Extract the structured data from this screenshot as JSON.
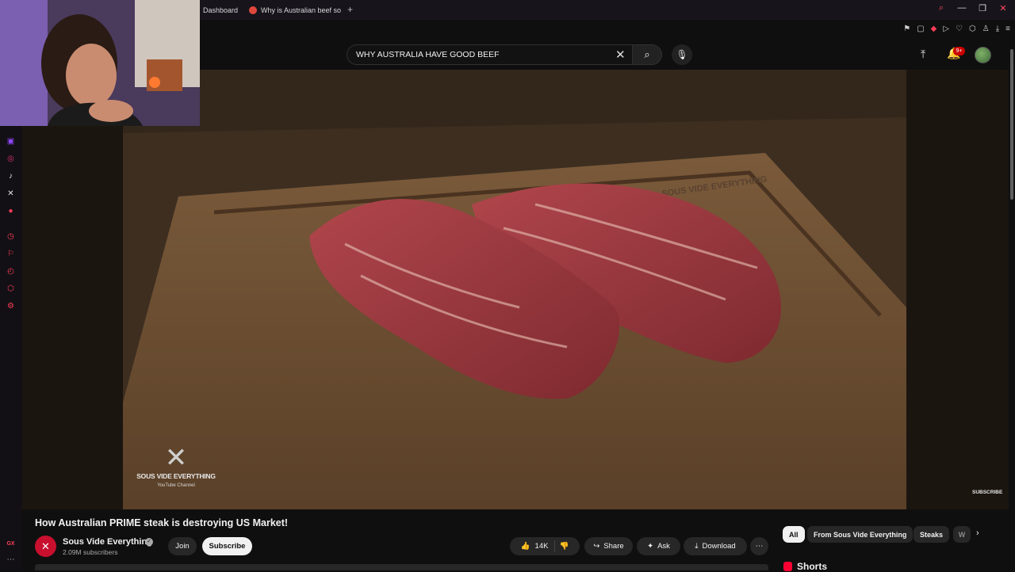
{
  "browser": {
    "tabs": [
      {
        "label": "Dashboard"
      },
      {
        "label": "Why is Australian beef so"
      }
    ],
    "new_tab": "+"
  },
  "search": {
    "value": "WHY AUSTRALIA HAVE GOOD BEEF"
  },
  "header": {
    "notifications_badge": "9+"
  },
  "video": {
    "watermark_brand": "SOUS VIDE EVERYTHING",
    "watermark_tag": "YouTube Channel",
    "board_engraving": "SOUS VIDE EVERYTHING",
    "end_subscribe": "SUBSCRIBE"
  },
  "meta": {
    "title": "How Australian PRIME steak is destroying US Market!",
    "channel": "Sous Vide Everything",
    "subscribers": "2.09M subscribers",
    "join_label": "Join",
    "subscribe_label": "Subscribe",
    "likes": "14K",
    "share_label": "Share",
    "ask_label": "Ask",
    "download_label": "Download"
  },
  "chips": [
    {
      "label": "All",
      "active": true
    },
    {
      "label": "From Sous Vide Everything"
    },
    {
      "label": "Steaks"
    },
    {
      "label": "W"
    }
  ],
  "shorts_label": "Shorts",
  "colors": {
    "accent_red": "#ff0033",
    "opera_red": "#ff3d57",
    "background": "#0f0f0f"
  }
}
